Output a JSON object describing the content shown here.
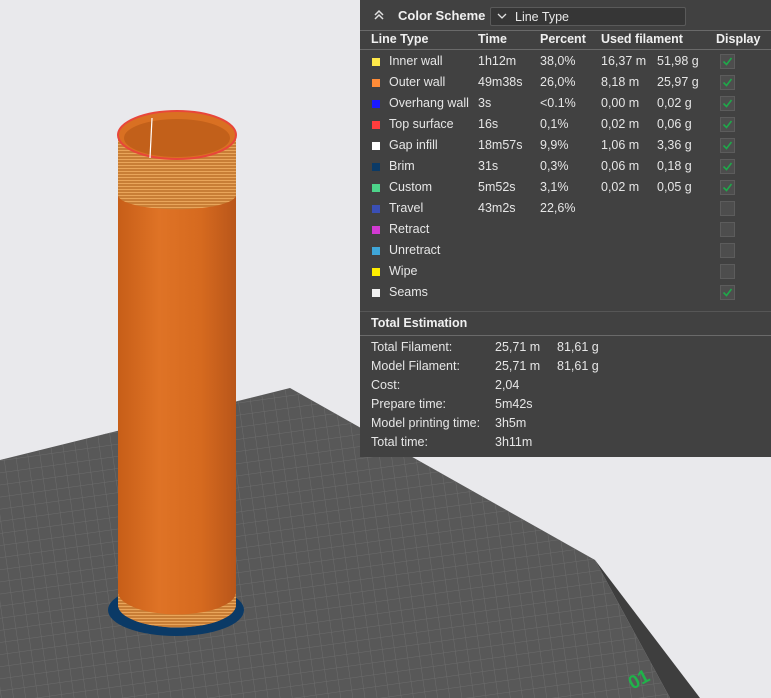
{
  "viewport": {
    "plate_label": "01"
  },
  "legend": {
    "color_scheme_label": "Color Scheme",
    "selected_scheme": "Line Type",
    "headers": [
      "Line Type",
      "Time",
      "Percent",
      "Used filament",
      "Display"
    ],
    "rows": [
      {
        "name": "Inner wall",
        "color": "#ffe94a",
        "time": "1h12m",
        "percent": "38,0%",
        "length": "16,37 m",
        "weight": "51,98 g",
        "display": true
      },
      {
        "name": "Outer wall",
        "color": "#ff8c38",
        "time": "49m38s",
        "percent": "26,0%",
        "length": "8,18 m",
        "weight": "25,97 g",
        "display": true
      },
      {
        "name": "Overhang wall",
        "color": "#1a1aff",
        "time": "3s",
        "percent": "<0.1%",
        "length": "0,00 m",
        "weight": "0,02 g",
        "display": true
      },
      {
        "name": "Top surface",
        "color": "#ff3d3d",
        "time": "16s",
        "percent": "0,1%",
        "length": "0,02 m",
        "weight": "0,06 g",
        "display": true
      },
      {
        "name": "Gap infill",
        "color": "#ffffff",
        "time": "18m57s",
        "percent": "9,9%",
        "length": "1,06 m",
        "weight": "3,36 g",
        "display": true
      },
      {
        "name": "Brim",
        "color": "#0b3a66",
        "time": "31s",
        "percent": "0,3%",
        "length": "0,06 m",
        "weight": "0,18 g",
        "display": true
      },
      {
        "name": "Custom",
        "color": "#4dd48a",
        "time": "5m52s",
        "percent": "3,1%",
        "length": "0,02 m",
        "weight": "0,05 g",
        "display": true
      },
      {
        "name": "Travel",
        "color": "#3a4fb5",
        "time": "43m2s",
        "percent": "22,6%",
        "length": "",
        "weight": "",
        "display": false
      },
      {
        "name": "Retract",
        "color": "#d23ad2",
        "time": "",
        "percent": "",
        "length": "",
        "weight": "",
        "display": false
      },
      {
        "name": "Unretract",
        "color": "#3fa6d8",
        "time": "",
        "percent": "",
        "length": "",
        "weight": "",
        "display": false
      },
      {
        "name": "Wipe",
        "color": "#ffee00",
        "time": "",
        "percent": "",
        "length": "",
        "weight": "",
        "display": false
      },
      {
        "name": "Seams",
        "color": "#f0f0f0",
        "time": "",
        "percent": "",
        "length": "",
        "weight": "",
        "display": true
      }
    ]
  },
  "estimation": {
    "title": "Total Estimation",
    "rows": [
      {
        "label": "Total Filament:",
        "value": "25,71 m",
        "extra": "81,61 g"
      },
      {
        "label": "Model Filament:",
        "value": "25,71 m",
        "extra": "81,61 g"
      },
      {
        "label": "Cost:",
        "value": "2,04",
        "extra": ""
      },
      {
        "label": "Prepare time:",
        "value": "5m42s",
        "extra": ""
      },
      {
        "label": "Model printing time:",
        "value": "3h5m",
        "extra": ""
      },
      {
        "label": "Total time:",
        "value": "3h11m",
        "extra": ""
      }
    ]
  },
  "colors": {
    "panel_bg": "#414141",
    "plate": "#585858",
    "tube_orange": "#d86d1f",
    "check_green": "#1fa84a"
  }
}
